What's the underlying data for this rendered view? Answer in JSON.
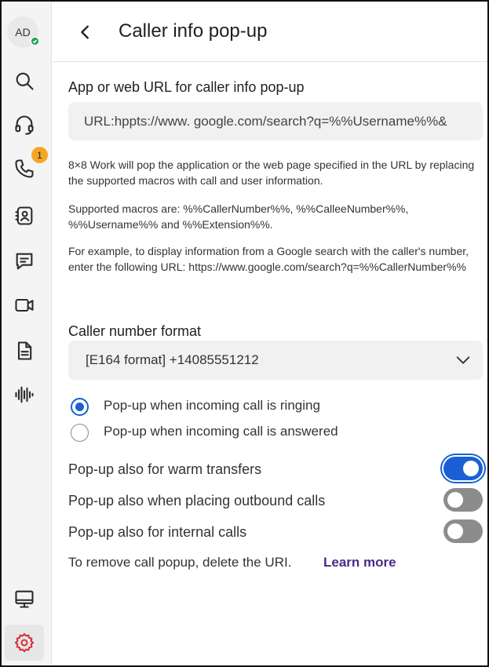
{
  "rail": {
    "avatar_initials": "AD",
    "calls_badge": "1",
    "items": [
      {
        "icon": "search-icon"
      },
      {
        "icon": "headset-icon"
      },
      {
        "icon": "phone-icon"
      },
      {
        "icon": "contacts-icon"
      },
      {
        "icon": "chat-icon"
      },
      {
        "icon": "video-icon"
      },
      {
        "icon": "document-icon"
      },
      {
        "icon": "voicemail-waveform-icon"
      },
      {
        "icon": "monitor-icon"
      },
      {
        "icon": "settings-gear-icon"
      }
    ]
  },
  "header": {
    "title": "Caller info pop-up"
  },
  "url_section": {
    "label": "App or web URL for caller info pop-up",
    "value": "URL:hppts://www. google.com/search?q=%%Username%%&",
    "help_1": "8×8 Work will pop the application or the web page specified in the URL by replacing the supported macros with call and user information.",
    "help_2": "Supported macros are: %%CallerNumber%%, %%CalleeNumber%%, %%Username%% and %%Extension%%.",
    "help_3": "For example, to display information from a Google search with the caller's number, enter the following URL: https://www.google.com/search?q=%%CallerNumber%%"
  },
  "number_format": {
    "label": "Caller number format",
    "selected": "[E164 format] +14085551212"
  },
  "popup_timing": {
    "options": [
      {
        "label": "Pop-up when incoming call is ringing",
        "checked": true
      },
      {
        "label": "Pop-up when incoming call is answered",
        "checked": false
      }
    ]
  },
  "toggles": [
    {
      "label": "Pop-up also for warm transfers",
      "on": true
    },
    {
      "label": "Pop-up also when placing outbound calls",
      "on": false
    },
    {
      "label": "Pop-up also for internal calls",
      "on": false
    }
  ],
  "footer": {
    "text": "To remove call popup, delete the URI.",
    "link": "Learn more"
  },
  "colors": {
    "accent": "#1a5fd6",
    "link": "#4b2a86",
    "badge": "#f5a623",
    "active_settings": "#d6323c",
    "presence": "#1f9d55"
  }
}
